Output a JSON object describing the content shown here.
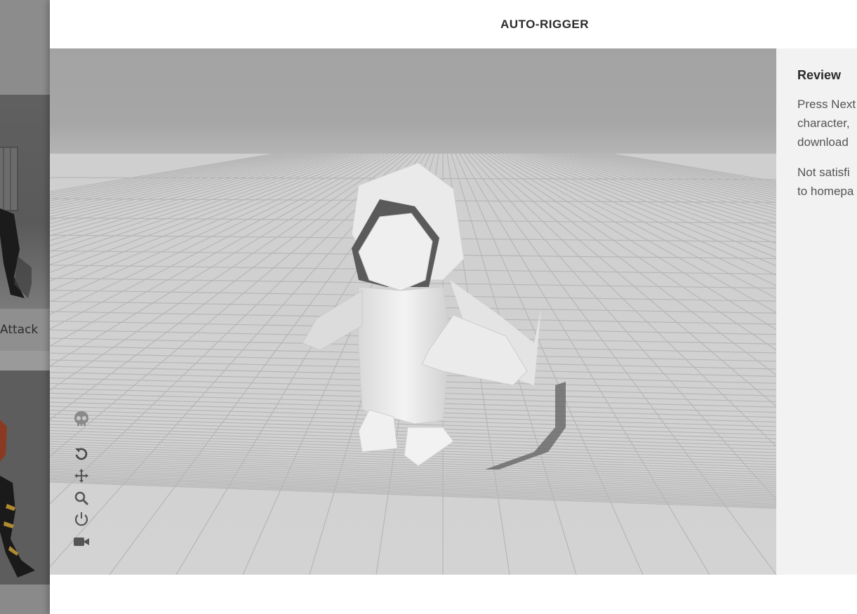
{
  "background_page": {
    "card1_label": "Attack"
  },
  "modal": {
    "title": "AUTO-RIGGER",
    "sidebar": {
      "heading": "Review",
      "paragraph1_lines": [
        "Press Next",
        "character,",
        "download"
      ],
      "paragraph2_lines": [
        "Not satisfi",
        "to homepa"
      ]
    },
    "viewport_tools": [
      {
        "icon": "skull-icon"
      },
      {
        "icon": "reset-icon"
      },
      {
        "icon": "pan-icon"
      },
      {
        "icon": "zoom-icon"
      },
      {
        "icon": "power-icon"
      },
      {
        "icon": "camera-icon"
      }
    ]
  },
  "colors": {
    "modal_bg": "#ffffff",
    "sidebar_bg": "#f2f2f2",
    "title_text": "#2b2b2b",
    "body_text": "#555555",
    "tool_icon": "#666666"
  }
}
